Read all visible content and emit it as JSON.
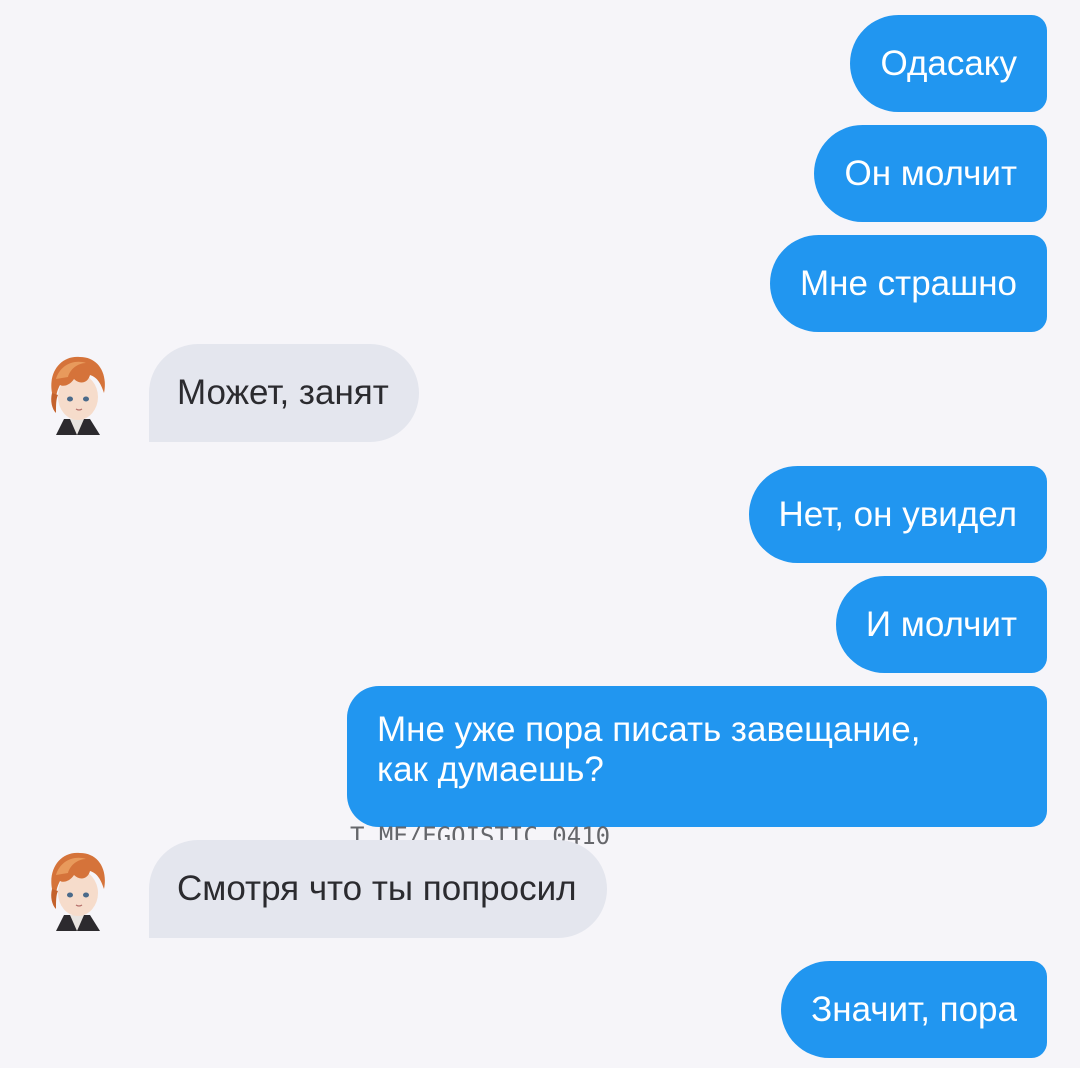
{
  "messages": [
    {
      "side": "out",
      "text": "Одасаку"
    },
    {
      "side": "out",
      "text": "Он молчит"
    },
    {
      "side": "out",
      "text": "Мне страшно"
    },
    {
      "side": "in",
      "text": "Может, занят"
    },
    {
      "side": "out",
      "text": "Нет, он увидел"
    },
    {
      "side": "out",
      "text": "И молчит"
    },
    {
      "side": "out",
      "line1": "Мне уже пора писать завещание,",
      "line2": "как думаешь?"
    },
    {
      "side": "in",
      "text": "Смотря что ты попросил"
    },
    {
      "side": "out",
      "text": "Значит, пора"
    }
  ],
  "watermark": "T.ME/EGOISTIC_0410",
  "colors": {
    "background": "#f6f5f9",
    "outgoing_bubble": "#2196f0",
    "incoming_bubble": "#e4e6ee"
  },
  "icons": {
    "avatar": "anime-avatar-orange-hair"
  }
}
